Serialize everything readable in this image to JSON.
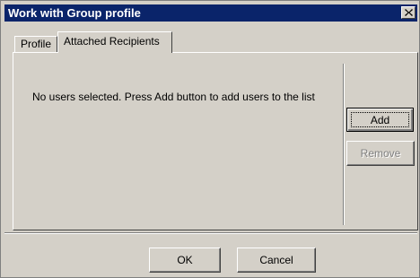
{
  "window": {
    "title": "Work with Group profile"
  },
  "tabs": [
    {
      "label": "Profile",
      "selected": false
    },
    {
      "label": "Attached Recipients",
      "selected": true
    }
  ],
  "list": {
    "empty_message": "No users selected. Press Add button to add users to the list"
  },
  "side_buttons": {
    "add_label": "Add",
    "remove_label": "Remove",
    "remove_enabled": false
  },
  "footer": {
    "ok_label": "OK",
    "cancel_label": "Cancel"
  },
  "colors": {
    "titlebar": "#0a246a",
    "face": "#d4d0c8"
  },
  "icons": {
    "close": "close-icon"
  }
}
